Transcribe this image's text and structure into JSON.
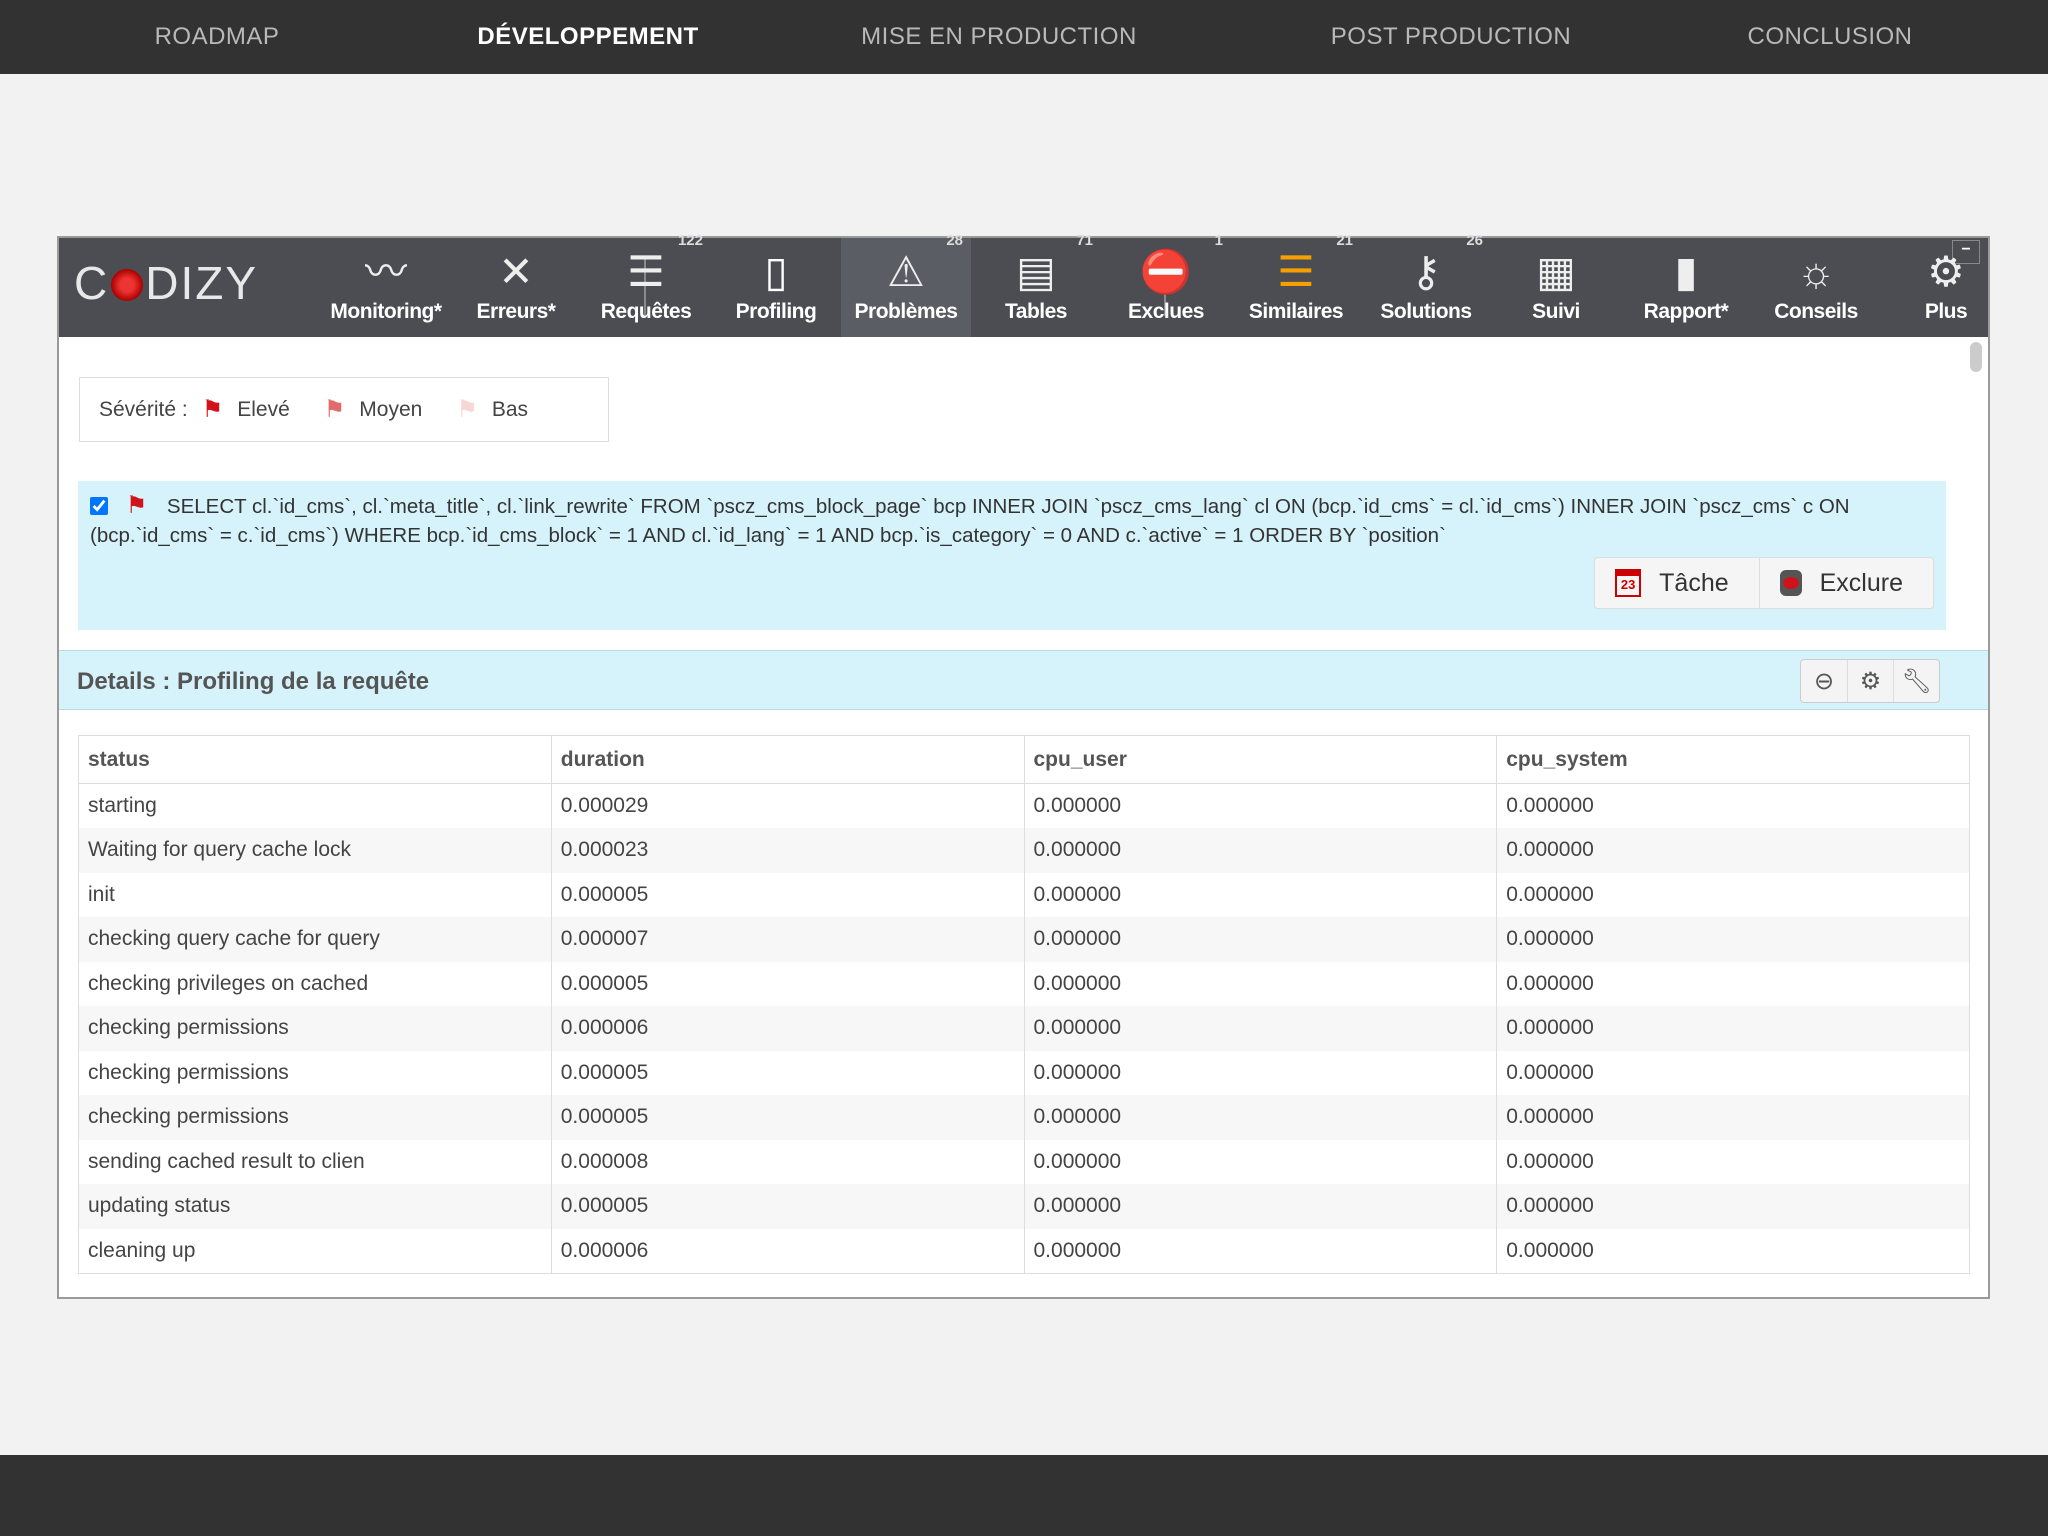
{
  "topnav": {
    "items": [
      "ROADMAP",
      "DÉVELOPPEMENT",
      "MISE EN PRODUCTION",
      "POST PRODUCTION",
      "CONCLUSION"
    ],
    "active": 1
  },
  "logo": {
    "text_left": "C",
    "text_right": "DIZY"
  },
  "toolbar": {
    "items": [
      {
        "label": "Monitoring*",
        "icon": "pulse-icon",
        "badge": ""
      },
      {
        "label": "Erreurs*",
        "icon": "x-icon",
        "badge": ""
      },
      {
        "label": "Requêtes",
        "icon": "database-icon",
        "badge": "122"
      },
      {
        "label": "Profiling",
        "icon": "php-file-icon",
        "badge": ""
      },
      {
        "label": "Problèmes",
        "icon": "warning-icon",
        "badge": "28"
      },
      {
        "label": "Tables",
        "icon": "table-icon",
        "badge": "71"
      },
      {
        "label": "Exclues",
        "icon": "database-excluded-icon",
        "badge": "1"
      },
      {
        "label": "Similaires",
        "icon": "database-similar-icon",
        "badge": "21"
      },
      {
        "label": "Solutions",
        "icon": "key-icon",
        "badge": "26"
      },
      {
        "label": "Suivi",
        "icon": "calendar-icon",
        "badge": ""
      },
      {
        "label": "Rapport*",
        "icon": "bar-chart-icon",
        "badge": ""
      },
      {
        "label": "Conseils",
        "icon": "lightbulb-icon",
        "badge": ""
      },
      {
        "label": "Plus",
        "icon": "gear-icon",
        "badge": ""
      }
    ],
    "active": 4,
    "minimize": "−"
  },
  "severity": {
    "label": "Sévérité :",
    "levels": [
      {
        "label": "Elevé",
        "color": "#d0121b"
      },
      {
        "label": "Moyen",
        "color": "#e36a6a"
      },
      {
        "label": "Bas",
        "color": "#f7d6d6"
      }
    ]
  },
  "query": {
    "checked": true,
    "text": "SELECT cl.`id_cms`, cl.`meta_title`, cl.`link_rewrite` FROM `pscz_cms_block_page` bcp INNER JOIN `pscz_cms_lang` cl ON (bcp.`id_cms` = cl.`id_cms`) INNER JOIN `pscz_cms` c ON (bcp.`id_cms` = c.`id_cms`) WHERE bcp.`id_cms_block` = 1 AND cl.`id_lang` = 1 AND bcp.`is_category` = 0 AND c.`active` = 1 ORDER BY `position`",
    "task_label": "Tâche",
    "task_day": "23",
    "exclude_label": "Exclure"
  },
  "details": {
    "title": "Details : Profiling de la requête"
  },
  "table": {
    "columns": [
      "status",
      "duration",
      "cpu_user",
      "cpu_system"
    ],
    "rows": [
      [
        "starting",
        "0.000029",
        "0.000000",
        "0.000000"
      ],
      [
        "Waiting for query cache lock",
        "0.000023",
        "0.000000",
        "0.000000"
      ],
      [
        "init",
        "0.000005",
        "0.000000",
        "0.000000"
      ],
      [
        "checking query cache for query",
        "0.000007",
        "0.000000",
        "0.000000"
      ],
      [
        "checking privileges on cached",
        "0.000005",
        "0.000000",
        "0.000000"
      ],
      [
        "checking permissions",
        "0.000006",
        "0.000000",
        "0.000000"
      ],
      [
        "checking permissions",
        "0.000005",
        "0.000000",
        "0.000000"
      ],
      [
        "checking permissions",
        "0.000005",
        "0.000000",
        "0.000000"
      ],
      [
        "sending cached result to clien",
        "0.000008",
        "0.000000",
        "0.000000"
      ],
      [
        "updating status",
        "0.000005",
        "0.000000",
        "0.000000"
      ],
      [
        "cleaning up",
        "0.000006",
        "0.000000",
        "0.000000"
      ]
    ]
  }
}
